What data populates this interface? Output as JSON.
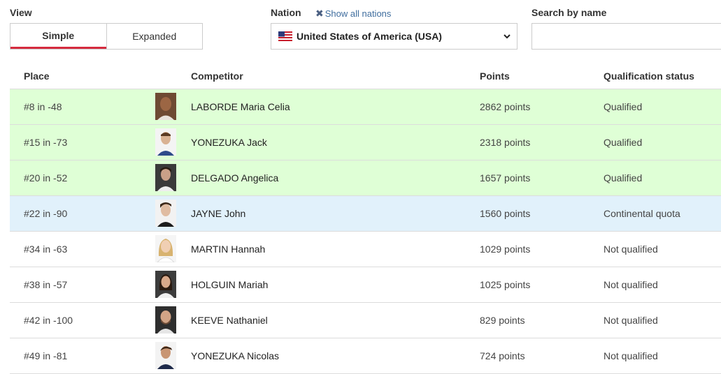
{
  "filters": {
    "view_label": "View",
    "view_options": [
      "Simple",
      "Expanded"
    ],
    "view_selected": "Simple",
    "nation_label": "Nation",
    "show_all_label": "Show all nations",
    "nation_value": "United States of America (USA)",
    "search_label": "Search by name",
    "search_value": ""
  },
  "table": {
    "headers": {
      "place": "Place",
      "competitor": "Competitor",
      "points": "Points",
      "status": "Qualification status"
    },
    "rows": [
      {
        "place": "#8 in -48",
        "competitor": "LABORDE Maria Celia",
        "points": "2862 points",
        "status": "Qualified",
        "status_type": "qualified"
      },
      {
        "place": "#15 in -73",
        "competitor": "YONEZUKA Jack",
        "points": "2318 points",
        "status": "Qualified",
        "status_type": "qualified"
      },
      {
        "place": "#20 in -52",
        "competitor": "DELGADO Angelica",
        "points": "1657 points",
        "status": "Qualified",
        "status_type": "qualified"
      },
      {
        "place": "#22 in -90",
        "competitor": "JAYNE John",
        "points": "1560 points",
        "status": "Continental quota",
        "status_type": "continental"
      },
      {
        "place": "#34 in -63",
        "competitor": "MARTIN Hannah",
        "points": "1029 points",
        "status": "Not qualified",
        "status_type": "not"
      },
      {
        "place": "#38 in -57",
        "competitor": "HOLGUIN Mariah",
        "points": "1025 points",
        "status": "Not qualified",
        "status_type": "not"
      },
      {
        "place": "#42 in -100",
        "competitor": "KEEVE Nathaniel",
        "points": "829 points",
        "status": "Not qualified",
        "status_type": "not"
      },
      {
        "place": "#49 in -81",
        "competitor": "YONEZUKA Nicolas",
        "points": "724 points",
        "status": "Not qualified",
        "status_type": "not"
      }
    ]
  },
  "colors": {
    "accent": "#d52b3f",
    "qualified_bg": "#dfffd6",
    "continental_bg": "#e1f1fb",
    "link": "#3f6d9e"
  },
  "icons": {
    "show_all": "close-x-icon",
    "flag": "usa-flag-icon",
    "select_arrow": "chevron-down-icon",
    "avatar": "athlete-photo"
  }
}
